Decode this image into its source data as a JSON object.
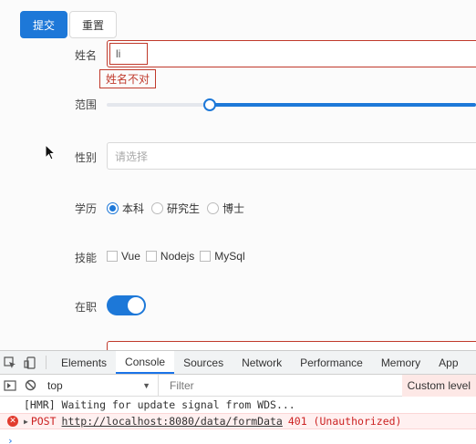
{
  "form": {
    "submit_label": "提交",
    "reset_label": "重置",
    "name": {
      "label": "姓名",
      "value": "li",
      "error": "姓名不对"
    },
    "range": {
      "label": "范围",
      "value_fraction": 0.28
    },
    "gender": {
      "label": "性别",
      "placeholder": "请选择"
    },
    "education": {
      "label": "学历",
      "options": [
        "本科",
        "研究生",
        "博士"
      ],
      "selected": "本科"
    },
    "skills": {
      "label": "技能",
      "options": [
        "Vue",
        "Nodejs",
        "MySql"
      ]
    },
    "employed": {
      "label": "在职",
      "on": true
    }
  },
  "devtools": {
    "tabs": [
      "Elements",
      "Console",
      "Sources",
      "Network",
      "Performance",
      "Memory",
      "App"
    ],
    "active_tab": "Console",
    "context": "top",
    "filter_placeholder": "Filter",
    "levels_label": "Custom level",
    "logs": [
      {
        "type": "info",
        "text": "[HMR] Waiting for update signal from WDS..."
      },
      {
        "type": "error",
        "method": "POST",
        "url": "http://localhost:8080/data/formData",
        "status": "401 (Unauthorized)"
      }
    ]
  }
}
